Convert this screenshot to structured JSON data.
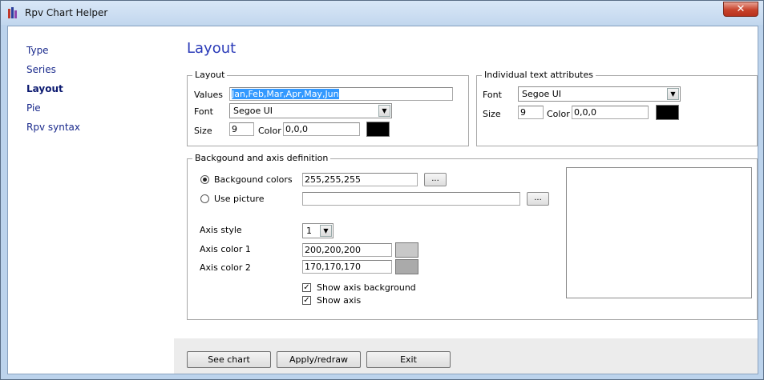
{
  "window": {
    "title": "Rpv Chart Helper",
    "close_glyph": "✕"
  },
  "sidebar": {
    "items": [
      {
        "label": "Type"
      },
      {
        "label": "Series"
      },
      {
        "label": "Layout"
      },
      {
        "label": "Pie"
      },
      {
        "label": "Rpv syntax"
      }
    ]
  },
  "page": {
    "title": "Layout"
  },
  "layout_group": {
    "legend": "Layout",
    "values_label": "Values",
    "values": "Jan,Feb,Mar,Apr,May,Jun",
    "font_label": "Font",
    "font": "Segoe UI",
    "size_label": "Size",
    "size": "9",
    "color_label": "Color",
    "color": "0,0,0",
    "color_hex": "#000000"
  },
  "text_group": {
    "legend": "Individual text attributes",
    "font_label": "Font",
    "font": "Segoe UI",
    "size_label": "Size",
    "size": "9",
    "color_label": "Color",
    "color": "0,0,0",
    "color_hex": "#000000"
  },
  "bg_group": {
    "legend": "Backgound and axis definition",
    "bg_colors_label": "Backgound colors",
    "bg_colors": "255,255,255",
    "use_picture_label": "Use picture",
    "picture": "",
    "browse_label": "...",
    "axis_style_label": "Axis style",
    "axis_style": "1",
    "axis_color1_label": "Axis color 1",
    "axis_color1": "200,200,200",
    "axis_color1_hex": "#c8c8c8",
    "axis_color2_label": "Axis color 2",
    "axis_color2": "170,170,170",
    "axis_color2_hex": "#aaaaaa",
    "show_axis_bg_label": "Show axis background",
    "show_axis_bg": true,
    "show_axis_label": "Show axis",
    "show_axis": true,
    "check_glyph": "✓"
  },
  "footer": {
    "see_chart": "See chart",
    "apply": "Apply/redraw",
    "exit": "Exit"
  }
}
